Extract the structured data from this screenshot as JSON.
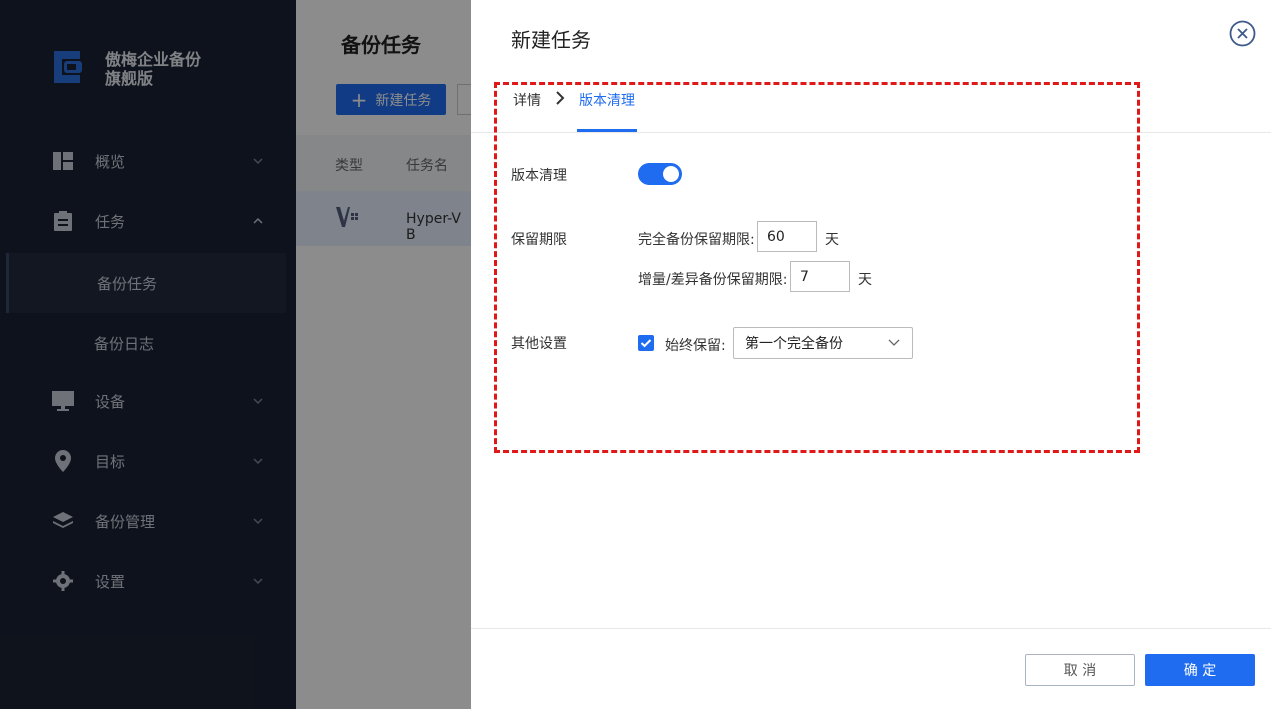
{
  "sidebar": {
    "brand_line1": "傲梅企业备份",
    "brand_line2": "旗舰版",
    "items": [
      {
        "label": "概览",
        "icon": "dashboard-icon"
      },
      {
        "label": "任务",
        "icon": "clipboard-icon"
      },
      {
        "label": "设备",
        "icon": "monitor-icon"
      },
      {
        "label": "目标",
        "icon": "location-pin-icon"
      },
      {
        "label": "备份管理",
        "icon": "layers-icon"
      },
      {
        "label": "设置",
        "icon": "gear-icon"
      }
    ],
    "subitems": [
      {
        "label": "备份任务",
        "active": true
      },
      {
        "label": "备份日志",
        "active": false
      }
    ]
  },
  "main": {
    "title": "备份任务",
    "new_button": "新建任务",
    "columns": [
      "类型",
      "任务名"
    ],
    "row": {
      "task_name": "Hyper-V B"
    }
  },
  "drawer": {
    "title": "新建任务",
    "breadcrumb": [
      "详情",
      "版本清理"
    ],
    "version_cleanup_label": "版本清理",
    "version_cleanup_enabled": true,
    "retention_label": "保留期限",
    "full_backup_label": "完全备份保留期限:",
    "full_backup_value": "60",
    "incremental_label": "增量/差异备份保留期限:",
    "incremental_value": "7",
    "unit": "天",
    "other_label": "其他设置",
    "always_keep_label": "始终保留:",
    "always_keep_checked": true,
    "always_keep_value": "第一个完全备份",
    "cancel": "取 消",
    "ok": "确 定"
  },
  "colors": {
    "accent": "#1f6cf0",
    "sidebar_bg": "#1b2233",
    "highlight_border": "#e01818"
  }
}
